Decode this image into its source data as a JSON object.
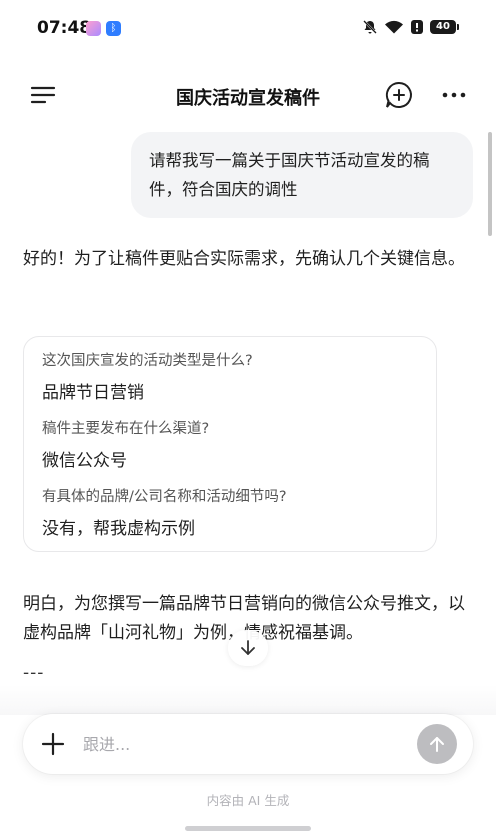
{
  "status_bar": {
    "time": "07:48",
    "battery": "40"
  },
  "header": {
    "title": "国庆活动宣发稿件"
  },
  "conversation": {
    "user_message": "请帮我写一篇关于国庆节活动宣发的稿件，符合国庆的调性",
    "assistant_intro": "好的！为了让稿件更贴合实际需求，先确认几个关键信息。",
    "qa": [
      {
        "question": "这次国庆宣发的活动类型是什么?",
        "answer": "品牌节日营销"
      },
      {
        "question": "稿件主要发布在什么渠道?",
        "answer": "微信公众号"
      },
      {
        "question": "有具体的品牌/公司名称和活动细节吗?",
        "answer": "没有，帮我虚构示例"
      }
    ],
    "assistant_reply": "明白，为您撰写一篇品牌节日营销向的微信公众号推文，以虚构品牌「山河礼物」为例，情感祝福基调。",
    "divider": "---"
  },
  "input": {
    "placeholder": "跟进..."
  },
  "footer": {
    "disclaimer": "内容由 AI 生成"
  },
  "icons": {
    "menu": "menu-icon",
    "new_chat": "new-chat-icon",
    "more": "more-icon",
    "scroll_down": "arrow-down-icon",
    "plus": "plus-icon",
    "send": "arrow-up-icon"
  },
  "colors": {
    "user_bubble": "#f3f4f6",
    "send_button_disabled": "#bdbdc0",
    "card_border": "#e8e8ea"
  }
}
